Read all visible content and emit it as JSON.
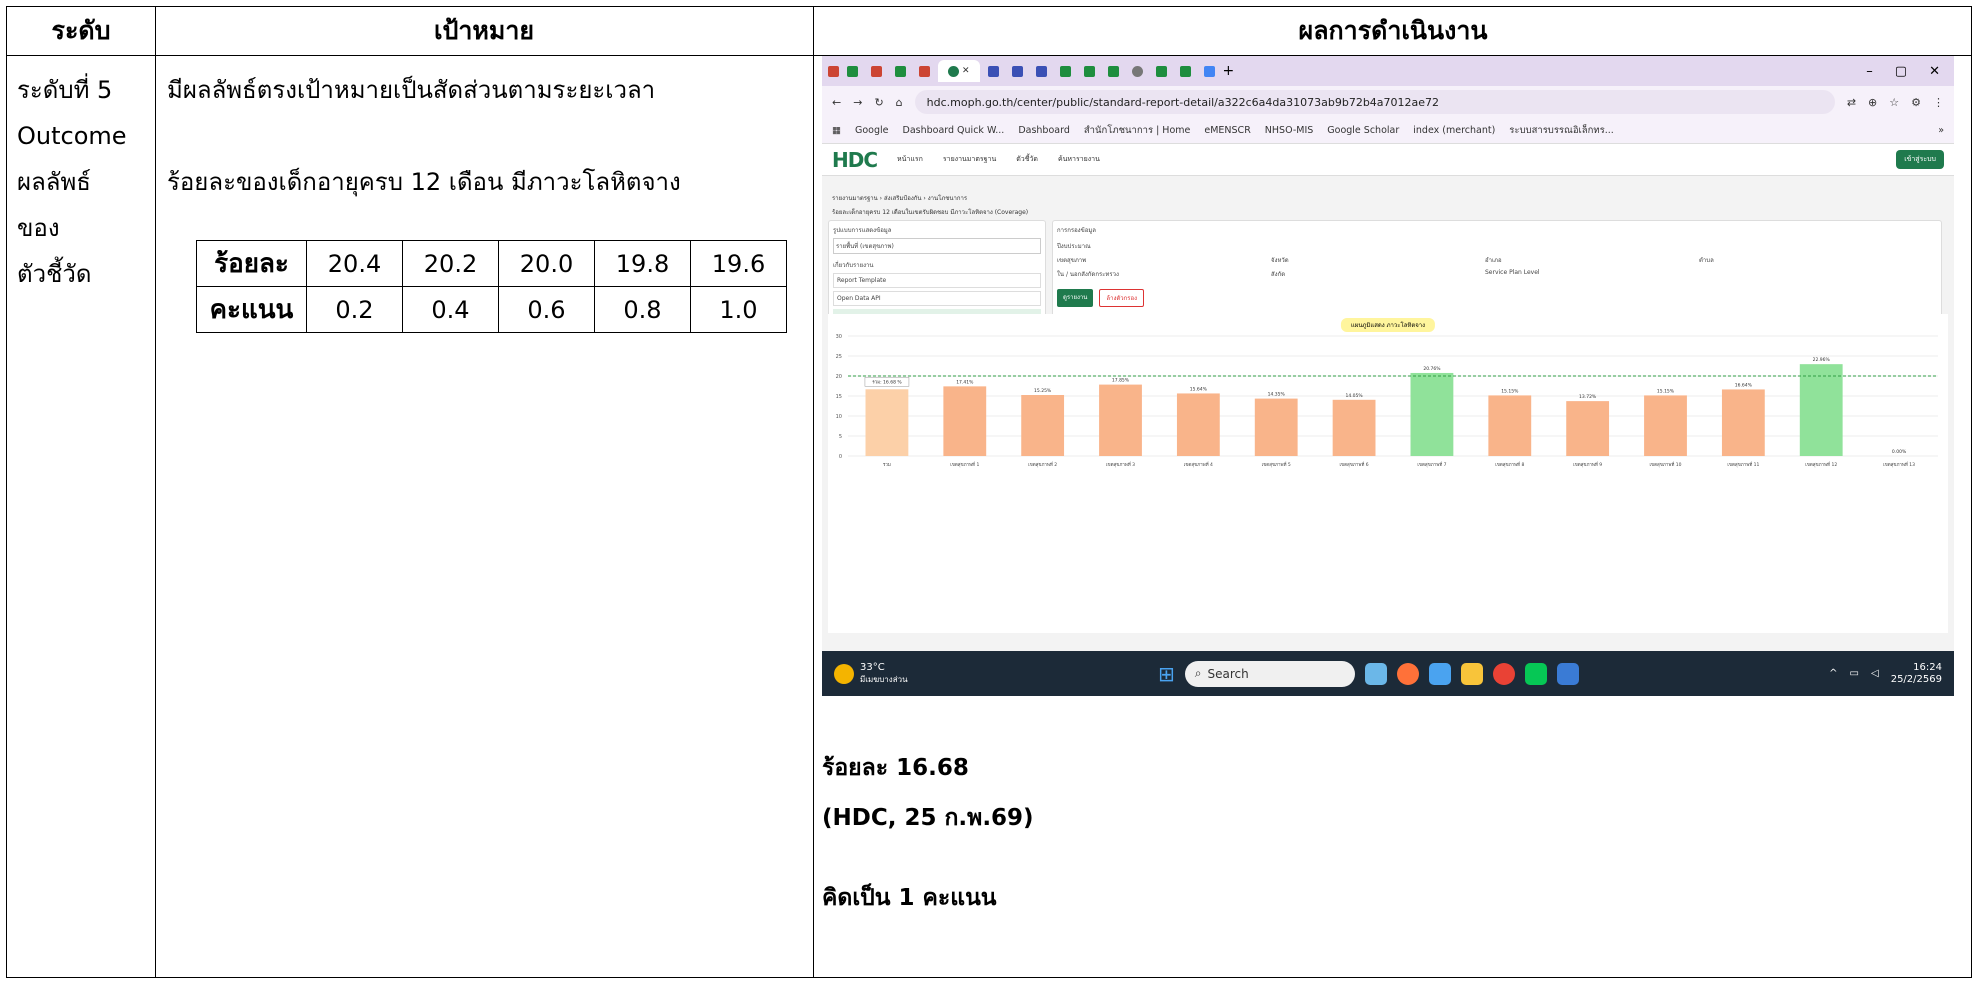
{
  "headers": {
    "level": "ระดับ",
    "target": "เป้าหมาย",
    "result": "ผลการดำเนินงาน"
  },
  "level_lines": [
    "ระดับที่ 5",
    "Outcome",
    "ผลลัพธ์",
    "ของ",
    "ตัวชี้วัด"
  ],
  "target": {
    "line1": "มีผลลัพธ์ตรงเป้าหมายเป็นสัดส่วนตามระยะเวลา",
    "line2": "ร้อยละของเด็กอายุครบ 12 เดือน มีภาวะโลหิตจาง",
    "table": {
      "row1_label": "ร้อยละ",
      "row1": [
        "20.4",
        "20.2",
        "20.0",
        "19.8",
        "19.6"
      ],
      "row2_label": "คะแนน",
      "row2": [
        "0.2",
        "0.4",
        "0.6",
        "0.8",
        "1.0"
      ]
    }
  },
  "result": {
    "value": "ร้อยละ 16.68",
    "source": "(HDC, 25 ก.พ.69)",
    "score": "คิดเป็น 1 คะแนน"
  },
  "screenshot": {
    "url": "hdc.moph.go.th/center/public/standard-report-detail/a322c6a4da31073ab9b72b4a7012ae72",
    "bookmarks": [
      "Google",
      "Dashboard Quick W...",
      "Dashboard",
      "สำนักโภชนาการ | Home",
      "eMENSCR",
      "NHSO-MIS",
      "Google Scholar",
      "index (merchant)",
      "ระบบสารบรรณอิเล็กทร..."
    ],
    "logo": "HDC",
    "login": "เข้าสู่ระบบ",
    "nav": [
      "หน้าแรก",
      "รายงานมาตรฐาน",
      "ตัวชี้วัด",
      "ค้นหารายงาน"
    ],
    "breadcrumb": "รายงานมาตรฐาน › ส่งเสริมป้องกัน › งานโภชนาการ",
    "report_title": "ร้อยละเด็กอายุครบ 12 เดือนในเขตรับผิดชอบ มีภาวะโลหิตจาง (Coverage)",
    "left_panel": [
      "รูปแบบการแสดงข้อมูล",
      "รายพื้นที่ (เขตสุขภาพ)",
      "เกี่ยวกับรายงาน",
      "Report Template",
      "Open Data API"
    ],
    "filter_title": "การกรองข้อมูล",
    "filters": [
      "ปีงบประมาณ",
      "เขตสุขภาพ",
      "จังหวัด",
      "อำเภอ",
      "ตำบล",
      "ใน / นอกสังกัดกระทรวง",
      "สังกัด",
      "Service Plan Level"
    ],
    "buttons": [
      "ดูรายงาน",
      "ล้างตัวกรอง"
    ],
    "chart_title": "แผนภูมิแสดง ภาวะโลหิตจาง",
    "tooltip": "รวม: 16.68 %",
    "weather": "33°C",
    "weather_desc": "มีเมฆบางส่วน",
    "taskbar_search": "Search",
    "time": "16:24",
    "date": "25/2/2569",
    "colors": {
      "bar_over": "#90e29a",
      "bar_under": "#f9b48a",
      "bar_total": "#fcd0a8",
      "target_line": "#2f9e44"
    }
  },
  "chart_data": {
    "type": "bar",
    "categories": [
      "รวม",
      "เขตสุขภาพที่ 1",
      "เขตสุขภาพที่ 2",
      "เขตสุขภาพที่ 3",
      "เขตสุขภาพที่ 4",
      "เขตสุขภาพที่ 5",
      "เขตสุขภาพที่ 6",
      "เขตสุขภาพที่ 7",
      "เขตสุขภาพที่ 8",
      "เขตสุขภาพที่ 9",
      "เขตสุขภาพที่ 10",
      "เขตสุขภาพที่ 11",
      "เขตสุขภาพที่ 12",
      "เขตสุขภาพที่ 13"
    ],
    "values": [
      16.68,
      17.41,
      15.25,
      17.85,
      15.64,
      14.35,
      14.05,
      20.76,
      15.15,
      13.72,
      15.15,
      16.64,
      22.96,
      0.0
    ],
    "labels": [
      "",
      "17.41%",
      "15.25%",
      "17.85%",
      "15.64%",
      "14.35%",
      "14.05%",
      "20.76%",
      "15.15%",
      "13.72%",
      "15.15%",
      "16.64%",
      "22.96%",
      "0.00%"
    ],
    "target": 20,
    "ylim": [
      0,
      30
    ],
    "yticks": [
      0,
      5,
      10,
      15,
      20,
      25,
      30
    ],
    "title": "แผนภูมิแสดง ภาวะโลหิตจาง"
  }
}
